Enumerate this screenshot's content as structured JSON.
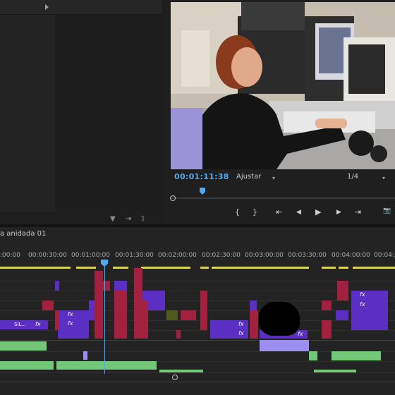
{
  "program": {
    "timecode": "00:01:11:38",
    "fit_label": "Ajustar",
    "quality_label": "1/4"
  },
  "controls": {
    "mark_in": "{",
    "mark_out": "}",
    "goto_in": "⇤",
    "step_back": "◀",
    "play": "▶",
    "step_forward": "▶",
    "goto_out": "⇥",
    "export_frame": "📷"
  },
  "timeline": {
    "sequence_title": "a anidada 01",
    "ruler": [
      ":00:00",
      "00:00:30:00",
      "00:01:00:00",
      "00:01:30:00",
      "00:02:00:00",
      "00:02:30:00",
      "00:03:00:00",
      "00:03:30:00",
      "00:04:00:00",
      "00:04:3"
    ],
    "clip_label": "SIL..."
  },
  "colors": {
    "accent": "#55a9ea",
    "video_red": "#a2213f",
    "video_purple": "#5a2fc2",
    "audio_green": "#73c779"
  }
}
